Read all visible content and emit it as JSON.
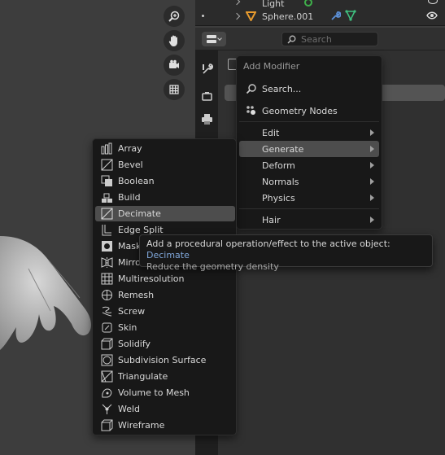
{
  "outliner": {
    "rows": [
      {
        "label": "Light"
      },
      {
        "label": "Sphere.001"
      }
    ]
  },
  "properties": {
    "search_placeholder": "Search"
  },
  "add_menu": {
    "title": "Add Modifier",
    "search_label": "Search...",
    "geometry_nodes_label": "Geometry Nodes",
    "categories": [
      {
        "label": "Edit"
      },
      {
        "label": "Generate"
      },
      {
        "label": "Deform"
      },
      {
        "label": "Normals"
      },
      {
        "label": "Physics"
      },
      {
        "label": "Hair"
      }
    ]
  },
  "generate_menu": {
    "items": [
      {
        "label": "Array",
        "icon": "array-icon"
      },
      {
        "label": "Bevel",
        "icon": "bevel-icon"
      },
      {
        "label": "Boolean",
        "icon": "boolean-icon"
      },
      {
        "label": "Build",
        "icon": "build-icon"
      },
      {
        "label": "Decimate",
        "icon": "decimate-icon"
      },
      {
        "label": "Edge Split",
        "icon": "edge-split-icon"
      },
      {
        "label": "Mask",
        "icon": "mask-icon"
      },
      {
        "label": "Mirror",
        "icon": "mirror-icon"
      },
      {
        "label": "Multiresolution",
        "icon": "multiresolution-icon"
      },
      {
        "label": "Remesh",
        "icon": "remesh-icon"
      },
      {
        "label": "Screw",
        "icon": "screw-icon"
      },
      {
        "label": "Skin",
        "icon": "skin-icon"
      },
      {
        "label": "Solidify",
        "icon": "solidify-icon"
      },
      {
        "label": "Subdivision Surface",
        "icon": "subdivision-surface-icon"
      },
      {
        "label": "Triangulate",
        "icon": "triangulate-icon"
      },
      {
        "label": "Volume to Mesh",
        "icon": "volume-to-mesh-icon"
      },
      {
        "label": "Weld",
        "icon": "weld-icon"
      },
      {
        "label": "Wireframe",
        "icon": "wireframe-icon"
      }
    ]
  },
  "tooltip": {
    "line1_prefix": "Add a procedural operation/effect to the active object: ",
    "line1_keyword": "Decimate",
    "line2": "Reduce the geometry density"
  },
  "colors": {
    "highlight": "#4d4d4d",
    "keyword": "#7fa6d9",
    "light_icon": "#3fae4a",
    "mesh_icon": "#e89b2e",
    "modifier_icon": "#5b8fd6",
    "geonodes_icon": "#3fbf7f"
  }
}
